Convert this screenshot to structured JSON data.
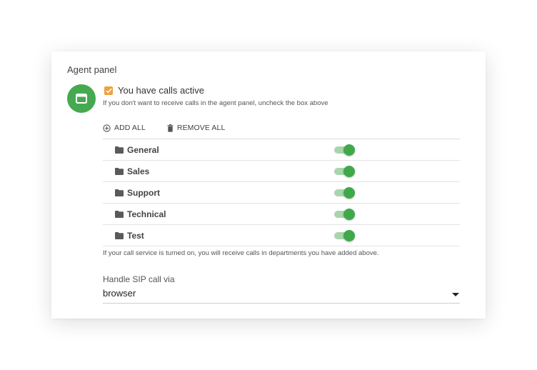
{
  "panel": {
    "title": "Agent panel"
  },
  "agent": {
    "icon": "browser-window-icon",
    "accent": "#45a94f",
    "calls_active": {
      "checked": true,
      "label": "You have calls active",
      "hint": "If you don't want to receive calls in the agent panel, uncheck the box above",
      "color": "#f0a03c"
    }
  },
  "actions": {
    "add_all": {
      "label": "ADD ALL",
      "icon": "add-circle-icon"
    },
    "remove_all": {
      "label": "REMOVE ALL",
      "icon": "trash-icon"
    }
  },
  "departments": {
    "items": [
      {
        "name": "General",
        "icon": "folder-icon",
        "enabled": true
      },
      {
        "name": "Sales",
        "icon": "folder-icon",
        "enabled": true
      },
      {
        "name": "Support",
        "icon": "folder-icon",
        "enabled": true
      },
      {
        "name": "Technical",
        "icon": "folder-icon",
        "enabled": true
      },
      {
        "name": "Test",
        "icon": "folder-icon",
        "enabled": true
      }
    ],
    "footnote": "If your call service is turned on, you will receive calls in departments you have added above.",
    "toggle_on_color": "#3fa94a"
  },
  "sip": {
    "label": "Handle SIP call via",
    "value": "browser",
    "icon": "dropdown-caret-icon"
  }
}
